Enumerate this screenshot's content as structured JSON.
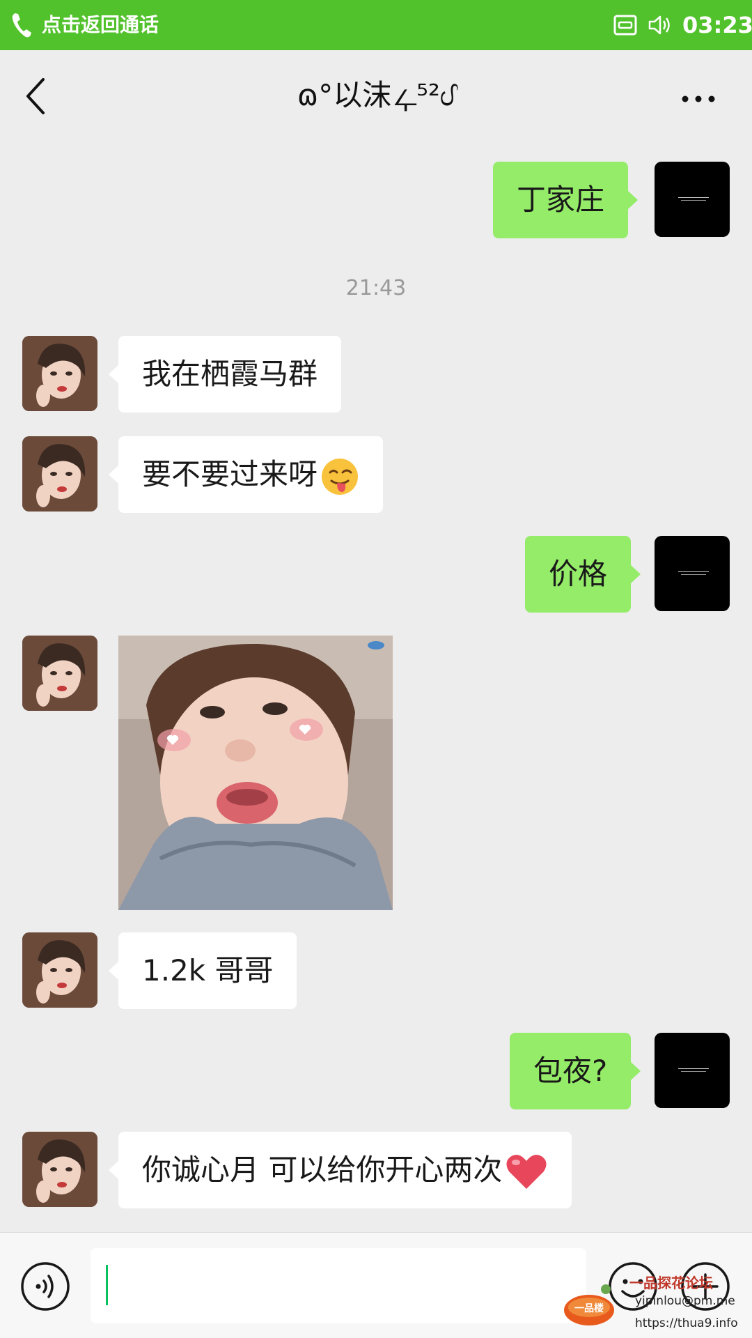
{
  "status_bar": {
    "call_text": "点击返回通话",
    "time": "03:23",
    "colors": {
      "background": "#52c22c",
      "text": "#ffffff"
    },
    "icons": [
      "phone-icon",
      "cast-icon",
      "volume-icon"
    ]
  },
  "header": {
    "title": "ɷ°以沫ഺ⁵²ᦔ",
    "back_icon": "chevron-left-icon",
    "more_icon": "more-dots-icon"
  },
  "chat": {
    "colors": {
      "background": "#ededed",
      "self_bubble": "#95ec69",
      "peer_bubble": "#ffffff"
    },
    "messages": [
      {
        "from": "self",
        "type": "text",
        "text": "丁家庄"
      },
      {
        "type": "time",
        "text": "21:43"
      },
      {
        "from": "peer",
        "type": "text",
        "text": "我在栖霞马群"
      },
      {
        "from": "peer",
        "type": "text",
        "text": "要不要过来呀",
        "emoji": "winking-tongue-emoji"
      },
      {
        "from": "self",
        "type": "text",
        "text": "价格"
      },
      {
        "from": "peer",
        "type": "image",
        "image": "toddler-face-sticker"
      },
      {
        "from": "peer",
        "type": "text",
        "text": "1.2k 哥哥"
      },
      {
        "from": "self",
        "type": "text",
        "text": "包夜?"
      },
      {
        "from": "peer",
        "type": "text",
        "text": "你诚心月 可以给你开心两次",
        "emoji": "heart-emoji"
      }
    ]
  },
  "input_bar": {
    "value": "",
    "icons": [
      "voice-icon",
      "emoji-icon",
      "add-icon"
    ],
    "caret_color": "#07c160"
  },
  "watermark": {
    "title": "一品探花论坛",
    "email": "yipinlou@pm.me",
    "url": "https://thua9.info",
    "logo_text": "一品楼"
  }
}
